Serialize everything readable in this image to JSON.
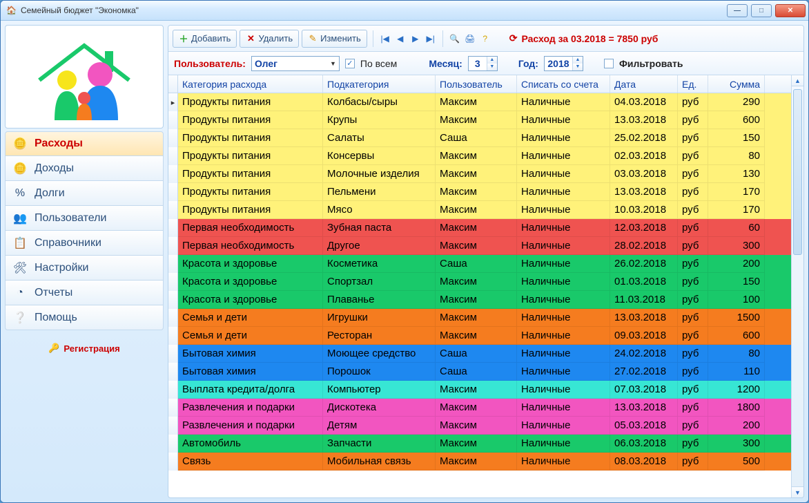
{
  "window": {
    "title": "Семейный бюджет \"Экономка\""
  },
  "toolbar": {
    "add": "Добавить",
    "delete": "Удалить",
    "edit": "Изменить",
    "expense_label": "Расход за 03.2018 = ",
    "expense_value": "7850 руб"
  },
  "filter": {
    "user_label": "Пользователь:",
    "user_value": "Олег",
    "all_label": "По всем",
    "month_label": "Месяц:",
    "month_value": "3",
    "year_label": "Год:",
    "year_value": "2018",
    "filter_label": "Фильтровать"
  },
  "sidebar": {
    "items": [
      {
        "label": "Расходы",
        "icon": "coins-minus"
      },
      {
        "label": "Доходы",
        "icon": "coins-plus"
      },
      {
        "label": "Долги",
        "icon": "percent"
      },
      {
        "label": "Пользователи",
        "icon": "users"
      },
      {
        "label": "Справочники",
        "icon": "list"
      },
      {
        "label": "Настройки",
        "icon": "tools"
      },
      {
        "label": "Отчеты",
        "icon": "pie"
      },
      {
        "label": "Помощь",
        "icon": "help"
      }
    ],
    "register": "Регистрация"
  },
  "grid": {
    "headers": {
      "category": "Категория расхода",
      "subcategory": "Подкатегория",
      "user": "Пользователь",
      "account": "Списать со счета",
      "date": "Дата",
      "unit": "Ед.",
      "sum": "Сумма"
    },
    "rows": [
      {
        "c": "Продукты питания",
        "s": "Колбасы/сыры",
        "u": "Максим",
        "a": "Наличные",
        "d": "04.03.2018",
        "e": "руб",
        "m": "290",
        "bg": "#fff27a",
        "sel": true
      },
      {
        "c": "Продукты питания",
        "s": "Крупы",
        "u": "Максим",
        "a": "Наличные",
        "d": "13.03.2018",
        "e": "руб",
        "m": "600",
        "bg": "#fff27a"
      },
      {
        "c": "Продукты питания",
        "s": "Салаты",
        "u": "Саша",
        "a": "Наличные",
        "d": "25.02.2018",
        "e": "руб",
        "m": "150",
        "bg": "#fff27a"
      },
      {
        "c": "Продукты питания",
        "s": "Консервы",
        "u": "Максим",
        "a": "Наличные",
        "d": "02.03.2018",
        "e": "руб",
        "m": "80",
        "bg": "#fff27a"
      },
      {
        "c": "Продукты питания",
        "s": "Молочные изделия",
        "u": "Максим",
        "a": "Наличные",
        "d": "03.03.2018",
        "e": "руб",
        "m": "130",
        "bg": "#fff27a"
      },
      {
        "c": "Продукты питания",
        "s": "Пельмени",
        "u": "Максим",
        "a": "Наличные",
        "d": "13.03.2018",
        "e": "руб",
        "m": "170",
        "bg": "#fff27a"
      },
      {
        "c": "Продукты питания",
        "s": "Мясо",
        "u": "Максим",
        "a": "Наличные",
        "d": "10.03.2018",
        "e": "руб",
        "m": "170",
        "bg": "#fff27a"
      },
      {
        "c": "Первая необходимость",
        "s": "Зубная паста",
        "u": "Максим",
        "a": "Наличные",
        "d": "12.03.2018",
        "e": "руб",
        "m": "60",
        "bg": "#ef5350"
      },
      {
        "c": "Первая необходимость",
        "s": "Другое",
        "u": "Максим",
        "a": "Наличные",
        "d": "28.02.2018",
        "e": "руб",
        "m": "300",
        "bg": "#ef5350"
      },
      {
        "c": "Красота и здоровье",
        "s": "Косметика",
        "u": "Саша",
        "a": "Наличные",
        "d": "26.02.2018",
        "e": "руб",
        "m": "200",
        "bg": "#19c96a"
      },
      {
        "c": "Красота и здоровье",
        "s": "Спортзал",
        "u": "Максим",
        "a": "Наличные",
        "d": "01.03.2018",
        "e": "руб",
        "m": "150",
        "bg": "#19c96a"
      },
      {
        "c": "Красота и здоровье",
        "s": "Плаванье",
        "u": "Максим",
        "a": "Наличные",
        "d": "11.03.2018",
        "e": "руб",
        "m": "100",
        "bg": "#19c96a"
      },
      {
        "c": "Семья и дети",
        "s": "Игрушки",
        "u": "Максим",
        "a": "Наличные",
        "d": "13.03.2018",
        "e": "руб",
        "m": "1500",
        "bg": "#f57c1f"
      },
      {
        "c": "Семья и дети",
        "s": "Ресторан",
        "u": "Максим",
        "a": "Наличные",
        "d": "09.03.2018",
        "e": "руб",
        "m": "600",
        "bg": "#f57c1f"
      },
      {
        "c": "Бытовая химия",
        "s": "Моющее средство",
        "u": "Саша",
        "a": "Наличные",
        "d": "24.02.2018",
        "e": "руб",
        "m": "80",
        "bg": "#1e88f0"
      },
      {
        "c": "Бытовая химия",
        "s": "Порошок",
        "u": "Саша",
        "a": "Наличные",
        "d": "27.02.2018",
        "e": "руб",
        "m": "110",
        "bg": "#1e88f0"
      },
      {
        "c": "Выплата кредита/долга",
        "s": "Компьютер",
        "u": "Максим",
        "a": "Наличные",
        "d": "07.03.2018",
        "e": "руб",
        "m": "1200",
        "bg": "#37e6d4"
      },
      {
        "c": "Развлечения и подарки",
        "s": "Дискотека",
        "u": "Максим",
        "a": "Наличные",
        "d": "13.03.2018",
        "e": "руб",
        "m": "1800",
        "bg": "#f255c0"
      },
      {
        "c": "Развлечения и подарки",
        "s": "Детям",
        "u": "Максим",
        "a": "Наличные",
        "d": "05.03.2018",
        "e": "руб",
        "m": "200",
        "bg": "#f255c0"
      },
      {
        "c": "Автомобиль",
        "s": "Запчасти",
        "u": "Максим",
        "a": "Наличные",
        "d": "06.03.2018",
        "e": "руб",
        "m": "300",
        "bg": "#19c96a"
      },
      {
        "c": "Связь",
        "s": "Мобильная связь",
        "u": "Максим",
        "a": "Наличные",
        "d": "08.03.2018",
        "e": "руб",
        "m": "500",
        "bg": "#f57c1f"
      }
    ]
  }
}
